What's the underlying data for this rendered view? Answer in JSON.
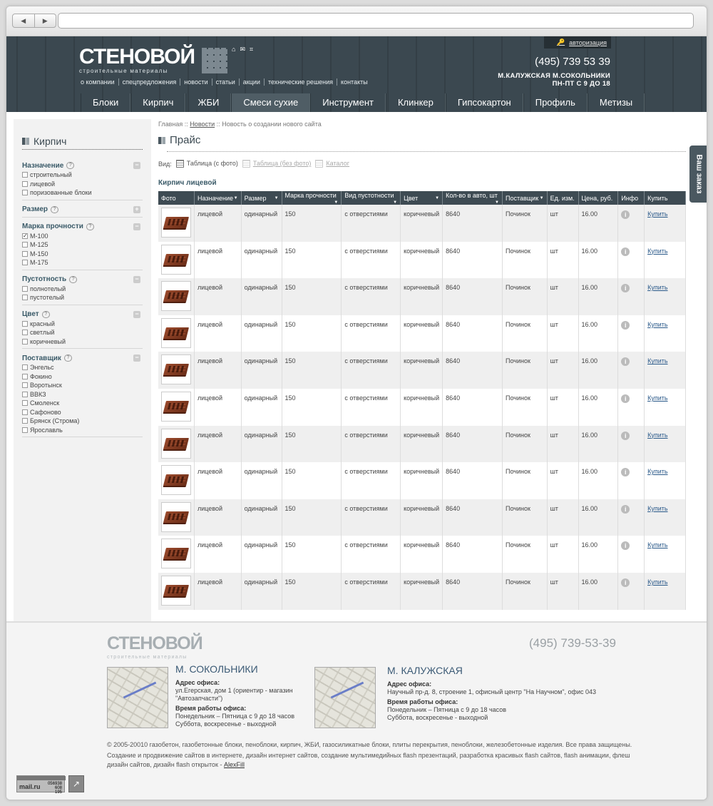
{
  "browser": {
    "back": "◀",
    "forward": "▶"
  },
  "header": {
    "logo": "СТЕНОВОЙ",
    "logo_sub": "строительные материалы",
    "auth": "авторизация",
    "phone": "(495) 739 53 39",
    "metro_line1": "М.КАЛУЖСКАЯ   М.СОКОЛЬНИКИ",
    "metro_line2": "ПН-ПТ С 9 ДО 18",
    "top_menu": [
      "о компании",
      "спецпредложения",
      "новости",
      "статьи",
      "акции",
      "технические решения",
      "контакты"
    ],
    "main_nav": [
      "Блоки",
      "Кирпич",
      "ЖБИ",
      "Смеси сухие",
      "Инструмент",
      "Клинкер",
      "Гипсокартон",
      "Профиль",
      "Метизы"
    ],
    "active_nav": "Смеси сухие"
  },
  "sidebar": {
    "title": "Кирпич",
    "filters": [
      {
        "title": "Назначение",
        "options": [
          "строительный",
          "лицевой",
          "поризованные блоки"
        ],
        "checked": []
      },
      {
        "title": "Размер",
        "options": [],
        "checked": []
      },
      {
        "title": "Марка прочности",
        "options": [
          "М-100",
          "М-125",
          "М-150",
          "М-175"
        ],
        "checked": [
          "М-100"
        ]
      },
      {
        "title": "Пустотность",
        "options": [
          "полнотелый",
          "пустотелый"
        ],
        "checked": []
      },
      {
        "title": "Цвет",
        "options": [
          "красный",
          "светлый",
          "коричневый"
        ],
        "checked": []
      },
      {
        "title": "Поставщик",
        "options": [
          "Энгельс",
          "Фокино",
          "Воротынск",
          "ВВКЗ",
          "Смоленск",
          "Сафоново",
          "Брянск (Строма)",
          "Ярославль"
        ],
        "checked": []
      }
    ]
  },
  "content": {
    "breadcrumb": {
      "home": "Главная",
      "sep": "::",
      "news": "Новости",
      "current": "Новость о создании нового сайта"
    },
    "title": "Прайс",
    "view_label": "Вид:",
    "views": [
      "Таблица (с фото)",
      "Таблица (без фото)",
      "Каталог"
    ],
    "section": "Кирпич лицевой",
    "columns": [
      "Фото",
      "Назначение",
      "Размер",
      "Марка прочности",
      "Вид пустотности",
      "Цвет",
      "Кол-во в авто, шт",
      "Поставщик",
      "Ед. изм.",
      "Цена, руб.",
      "Инфо",
      "Купить"
    ],
    "rows": [
      [
        "лицевой",
        "одинарный",
        "150",
        "с отверстиями",
        "коричневый",
        "8640",
        "Починок",
        "шт",
        "16.00",
        "Купить"
      ],
      [
        "лицевой",
        "одинарный",
        "150",
        "с отверстиями",
        "коричневый",
        "8640",
        "Починок",
        "шт",
        "16.00",
        "Купить"
      ],
      [
        "лицевой",
        "одинарный",
        "150",
        "с отверстиями",
        "коричневый",
        "8640",
        "Починок",
        "шт",
        "16.00",
        "Купить"
      ],
      [
        "лицевой",
        "одинарный",
        "150",
        "с отверстиями",
        "коричневый",
        "8640",
        "Починок",
        "шт",
        "16.00",
        "Купить"
      ],
      [
        "лицевой",
        "одинарный",
        "150",
        "с отверстиями",
        "коричневый",
        "8640",
        "Починок",
        "шт",
        "16.00",
        "Купить"
      ],
      [
        "лицевой",
        "одинарный",
        "150",
        "с отверстиями",
        "коричневый",
        "8640",
        "Починок",
        "шт",
        "16.00",
        "Купить"
      ],
      [
        "лицевой",
        "одинарный",
        "150",
        "с отверстиями",
        "коричневый",
        "8640",
        "Починок",
        "шт",
        "16.00",
        "Купить"
      ],
      [
        "лицевой",
        "одинарный",
        "150",
        "с отверстиями",
        "коричневый",
        "8640",
        "Починок",
        "шт",
        "16.00",
        "Купить"
      ],
      [
        "лицевой",
        "одинарный",
        "150",
        "с отверстиями",
        "коричневый",
        "8640",
        "Починок",
        "шт",
        "16.00",
        "Купить"
      ],
      [
        "лицевой",
        "одинарный",
        "150",
        "с отверстиями",
        "коричневый",
        "8640",
        "Починок",
        "шт",
        "16.00",
        "Купить"
      ],
      [
        "лицевой",
        "одинарный",
        "150",
        "с отверстиями",
        "коричневый",
        "8640",
        "Починок",
        "шт",
        "16.00",
        "Купить"
      ]
    ],
    "order_tab": "Ваш заказ"
  },
  "footer": {
    "logo": "СТЕНОВОЙ",
    "logo_sub": "строительные материалы",
    "phone": "(495) 739-53-39",
    "offices": [
      {
        "title": "М. СОКОЛЬНИКИ",
        "addr_label": "Адрес офиса:",
        "addr": "ул.Егерская, дом 1 (ориентир - магазин \"Автозапчасти\")",
        "hours_label": "Время работы офиса:",
        "hours1": "Понедельник – Пятница с 9 до 18 часов",
        "hours2": "Суббота, воскресенье - выходной"
      },
      {
        "title": "М. КАЛУЖСКАЯ",
        "addr_label": "Адрес офиса:",
        "addr": "Научный пр-д. 8, строение 1, офисный центр \"На Научном\", офис 043",
        "hours_label": "Время работы офиса:",
        "hours1": "Понедельник – Пятница с 9 до 18 часов",
        "hours2": "Суббота, воскресенье - выходной"
      }
    ],
    "copyright": "© 2005-20010 газобетон, газобетонные блоки, пеноблоки, кирпич, ЖБИ, газосиликатные блоки, плиты перекрытия, пеноблоки, железобетонные изделия. Все права защищены.",
    "credits": "Создание и продвижение сайтов в интернете, дизайн интернет сайтов, создание мультимедийных flash презентаций, разработка красивых flash сайтов, flash анимации, флеш дизайн сайтов, дизайн flash открыток - ",
    "credits_link": "AlexFill",
    "counter": {
      "label": "mail.ru",
      "n1": "056938",
      "n2": "608",
      "n3": "195"
    }
  }
}
